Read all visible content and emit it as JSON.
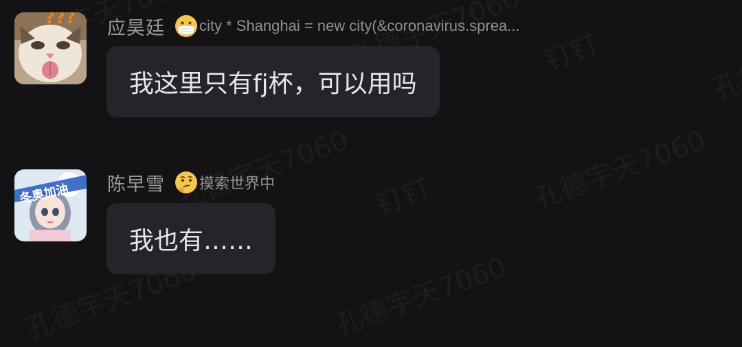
{
  "watermark": {
    "name_text": "孔德宇天7060",
    "brand_text": "钉钉"
  },
  "messages": [
    {
      "sender": "应昊廷",
      "status_icon": "mask-face-emoji",
      "status_text": "city * Shanghai = new city(&coronavirus.sprea...",
      "text": "我这里只有fj杯，可以用吗"
    },
    {
      "sender": "陈早雪",
      "status_icon": "thinking-face-emoji",
      "status_text": "摸索世界中",
      "text": "我也有……"
    }
  ],
  "colors": {
    "background": "#131316",
    "bubble": "#24252a",
    "message_text": "#e7e7ea",
    "meta_text": "#9a9a9f"
  }
}
